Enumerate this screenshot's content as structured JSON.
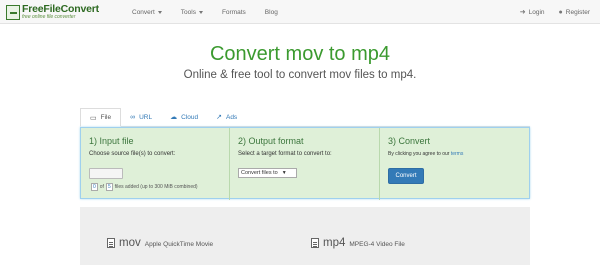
{
  "nav": {
    "logo_name": "FreeFileConvert",
    "logo_tagline": "free online file converter",
    "convert": "Convert",
    "tools": "Tools",
    "formats": "Formats",
    "blog": "Blog",
    "login": "Login",
    "register": "Register"
  },
  "hero": {
    "title": "Convert mov to mp4",
    "subtitle": "Online & free tool to convert mov files to mp4."
  },
  "tabs": [
    "File",
    "URL",
    "Cloud",
    "Ads"
  ],
  "steps": {
    "input": {
      "heading": "1) Input file",
      "instruction": "Choose source file(s) to convert:",
      "count_current": "0",
      "count_of": "of",
      "count_max": "5",
      "count_note": "files added (up to 300 MiB combined)"
    },
    "output": {
      "heading": "2) Output format",
      "instruction": "Select a target format to convert to:",
      "select_value": "Convert files to"
    },
    "convert": {
      "heading": "3) Convert",
      "terms_prefix": "By clicking you agree to our",
      "terms_link": "terms",
      "button": "Convert"
    }
  },
  "formats": {
    "source_ext": "mov",
    "source_desc": "Apple QuickTime Movie",
    "target_ext": "mp4",
    "target_desc": "MPEG-4 Video File"
  },
  "colors": {
    "brand_green": "#3b9a2f",
    "panel_bg": "#dff0d8",
    "link_blue": "#337ab7"
  }
}
